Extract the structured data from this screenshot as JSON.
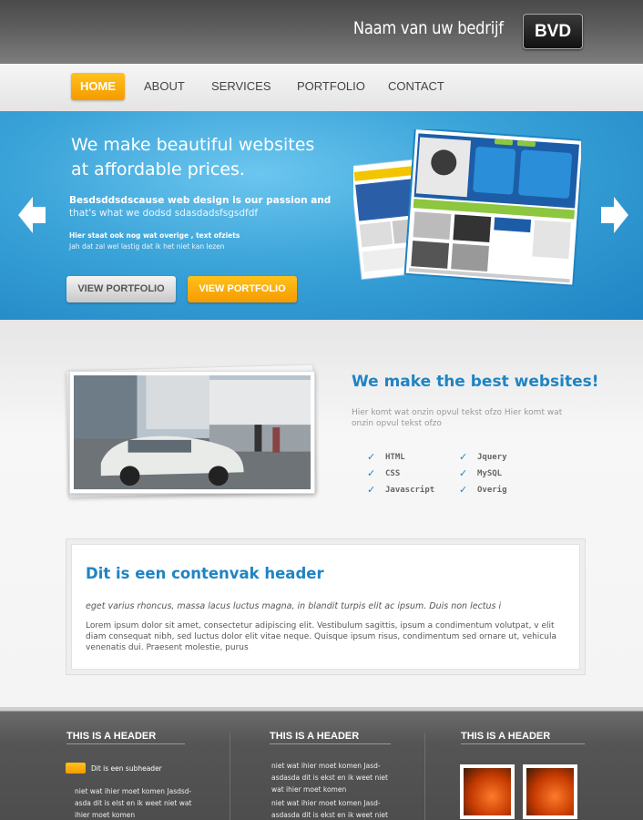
{
  "header": {
    "company_name": "Naam van uw bedrijf",
    "logo_text": "BVD"
  },
  "nav": {
    "items": [
      {
        "label": "HOME",
        "active": true
      },
      {
        "label": "ABOUT"
      },
      {
        "label": "SERVICES"
      },
      {
        "label": "PORTFOLIO"
      },
      {
        "label": "CONTACT"
      }
    ]
  },
  "hero": {
    "title_line1": "We make beautiful websites",
    "title_line2": "at affordable prices.",
    "sub1": "Besdsddsdscause web design is our passion and",
    "sub2": "that's what we dodsd sdasdadsfsgsdfdf",
    "small1": "Hier staat ook nog wat overige , text ofziets",
    "small2": "Jah dat zal wel  lastig dat ik het niet kan lezen",
    "btn_grey": "VIEW PORTFOLIO",
    "btn_orange": "VIEW PORTFOLIO"
  },
  "features": {
    "title": "We make the best websites!",
    "text": "Hier komt wat onzin opvul tekst ofzo Hier komt wat onzin opvul tekst ofzo",
    "col1": [
      "HTML",
      "CSS",
      "Javascript"
    ],
    "col2": [
      "Jquery",
      "MySQL",
      "Overig"
    ]
  },
  "content": {
    "header": "Dit is een contenvak header",
    "italic": "eget varius rhoncus, massa lacus luctus magna, in blandit turpis elit ac ipsum. Duis non lectus i",
    "body": "Lorem ipsum dolor sit amet, consectetur adipiscing elit. Vestibulum sagittis, ipsum a condimentum volutpat, v elit diam consequat nibh, sed luctus dolor elit vitae neque. Quisque ipsum risus, condimentum sed ornare ut, vehicula venenatis dui. Praesent molestie, purus"
  },
  "footer": {
    "col1_header": "THIS IS A HEADER",
    "col2_header": "THIS IS A HEADER",
    "col3_header": "THIS IS A HEADER",
    "subheader": "Dit is een subheader",
    "col1_text": "niet wat ihier moet komen Jasdsd-asda dit is elst en ik weet niet wat ihier moet komen",
    "col2_text_a": "niet wat ihier moet komen Jasd-asdasda dit is ekst en ik weet niet wat ihier moet komen",
    "col2_text_b": "niet wat ihier moet komen Jasd-asdasda dit is ekst en ik weet niet"
  },
  "colors": {
    "accent_blue": "#1f84c4",
    "accent_orange": "#f59a00"
  }
}
